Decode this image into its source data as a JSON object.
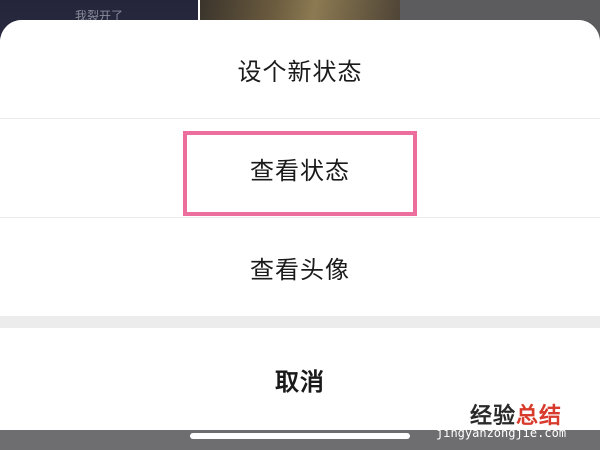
{
  "background": {
    "top_left_caption": "我裂开了"
  },
  "action_sheet": {
    "options": [
      {
        "label": "设个新状态"
      },
      {
        "label": "查看状态"
      },
      {
        "label": "查看头像"
      }
    ],
    "cancel_label": "取消"
  },
  "watermark": {
    "chinese_part1": "经验",
    "chinese_part2": "总结",
    "url": "jingyanzongjie.com"
  },
  "colors": {
    "highlight_border": "#ec6e9c",
    "sheet_background": "#ffffff",
    "separator": "#ececec",
    "watermark_accent": "#d83a2c"
  }
}
